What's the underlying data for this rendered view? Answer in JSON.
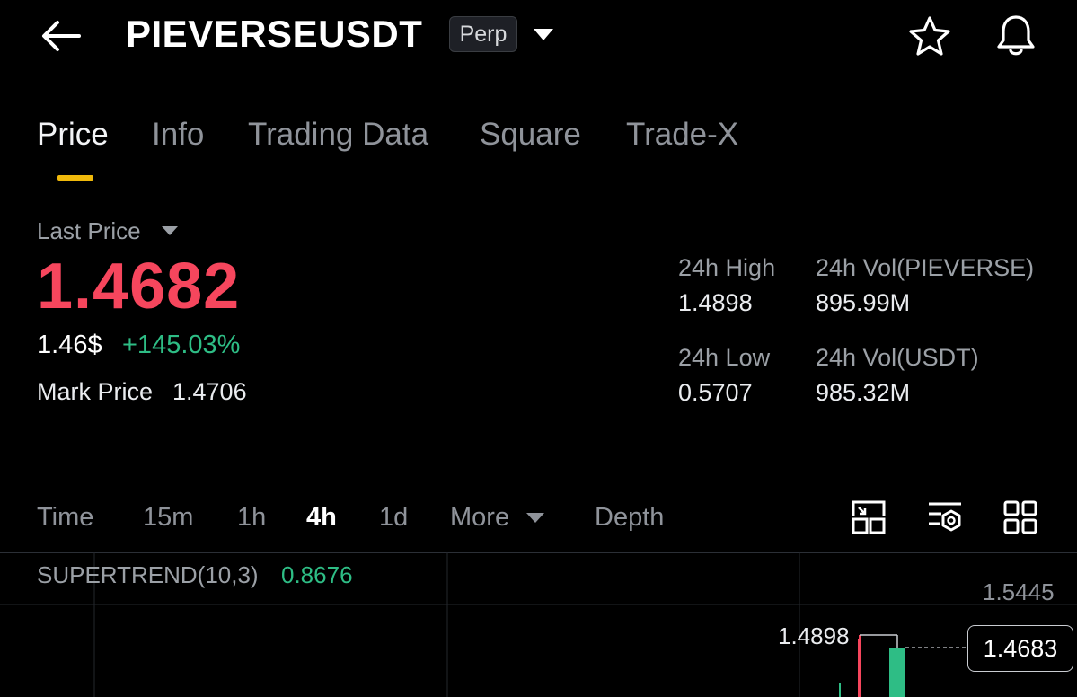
{
  "header": {
    "symbol": "PIEVERSEUSDT",
    "badge": "Perp",
    "icons": [
      "back-arrow-icon",
      "star-icon",
      "bell-icon"
    ]
  },
  "tabs": [
    {
      "label": "Price",
      "active": true
    },
    {
      "label": "Info"
    },
    {
      "label": "Trading Data"
    },
    {
      "label": "Square"
    },
    {
      "label": "Trade-X"
    }
  ],
  "price": {
    "label": "Last Price",
    "last": "1.4682",
    "usd": "1.46$",
    "change": "+145.03%",
    "mark_label": "Mark Price",
    "mark_value": "1.4706"
  },
  "stats": {
    "high_label": "24h High",
    "high_value": "1.4898",
    "low_label": "24h Low",
    "low_value": "0.5707",
    "vol_base_label": "24h Vol(PIEVERSE)",
    "vol_base_value": "895.99M",
    "vol_quote_label": "24h Vol(USDT)",
    "vol_quote_value": "985.32M"
  },
  "intervals": {
    "time": "Time",
    "m15": "15m",
    "h1": "1h",
    "h4": "4h",
    "d1": "1d",
    "more": "More",
    "depth": "Depth",
    "active": "4h"
  },
  "chart": {
    "indicator_label": "SUPERTREND(10,3)",
    "indicator_value": "0.8676",
    "axis_top": "1.5445",
    "high_marker": "1.4898",
    "current_price": "1.4683",
    "colors": {
      "up": "#2ebd85",
      "down": "#f6465d",
      "accent": "#f0b90b"
    }
  }
}
